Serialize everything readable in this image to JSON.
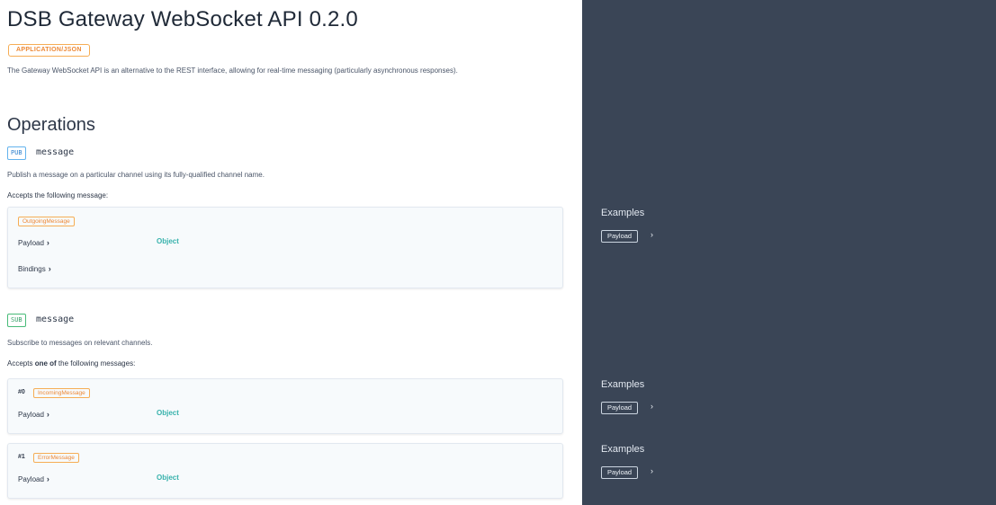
{
  "header": {
    "title": "DSB Gateway WebSocket API 0.2.0",
    "content_type": "APPLICATION/JSON",
    "description": "The Gateway WebSocket API is an alternative to the REST interface, allowing for real-time messaging (particularly asynchronous responses)."
  },
  "operations": {
    "heading": "Operations",
    "pub": {
      "badge": "PUB",
      "name": "message",
      "description": "Publish a message on a particular channel using its fully-qualified channel name.",
      "accepts": "Accepts the following message:",
      "message": {
        "name": "OutgoingMessage",
        "payload_label": "Payload",
        "payload_type": "Object",
        "bindings_label": "Bindings"
      }
    },
    "sub": {
      "badge": "SUB",
      "name": "message",
      "description": "Subscribe to messages on relevant channels.",
      "accepts_prefix": "Accepts ",
      "accepts_bold": "one of",
      "accepts_suffix": " the following messages:",
      "messages": [
        {
          "index": "#0",
          "name": "IncomingMessage",
          "payload_label": "Payload",
          "payload_type": "Object"
        },
        {
          "index": "#1",
          "name": "ErrorMessage",
          "payload_label": "Payload",
          "payload_type": "Object"
        }
      ]
    }
  },
  "sidebar": {
    "examples": [
      {
        "label": "Examples",
        "button": "Payload"
      },
      {
        "label": "Examples",
        "button": "Payload"
      },
      {
        "label": "Examples",
        "button": "Payload"
      }
    ]
  },
  "icons": {
    "chevron": "chevron-right-icon"
  },
  "colors": {
    "sidebar_bg": "#3a4556",
    "accent_orange": "#ed8936",
    "pub_blue": "#3182ce",
    "sub_green": "#38a169",
    "object_teal": "#38b2ac"
  }
}
